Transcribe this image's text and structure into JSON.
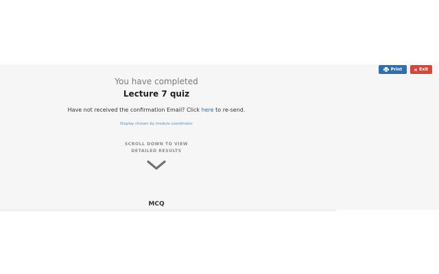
{
  "toolbar": {
    "print_label": "Print",
    "exit_label": "Exit",
    "print_color": "#2f6fb0",
    "exit_color": "#d9443b"
  },
  "result": {
    "completed_text": "You have completed",
    "quiz_title": "Lecture 7 quiz",
    "confirm_prefix": "Have not received the confirmation Email? Click ",
    "confirm_link": "here",
    "confirm_suffix": " to re-send.",
    "display_note": "Display chosen by module coordinator",
    "scroll_line1": "SCROLL DOWN TO VIEW",
    "scroll_line2": "DETAILED RESULTS",
    "section_label": "MCQ"
  },
  "icons": {
    "print": "printer-icon",
    "exit": "close-icon",
    "scroll": "chevron-down-icon"
  }
}
